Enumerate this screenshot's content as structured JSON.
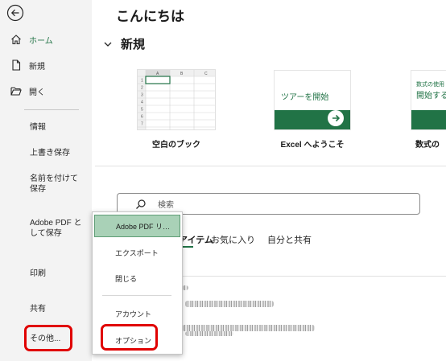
{
  "sidebar": {
    "items": [
      {
        "label": "ホーム",
        "icon": "home-icon"
      },
      {
        "label": "新規",
        "icon": "new-document-icon"
      },
      {
        "label": "開く",
        "icon": "open-folder-icon"
      }
    ],
    "text_items": [
      "情報",
      "上書き保存",
      "名前を付けて保存",
      "Adobe PDF として保存",
      "印刷",
      "共有",
      "その他..."
    ]
  },
  "main": {
    "greeting": "こんにちは",
    "new_section": "新規",
    "templates": [
      {
        "label": "空白のブック"
      },
      {
        "label": "Excel へようこそ",
        "tile_text": "ツアーを開始"
      },
      {
        "label": "数式の",
        "tile_text_small": "数式の使用",
        "tile_text": "開始する"
      }
    ],
    "spreadsheet": {
      "columns": [
        "A",
        "B",
        "C"
      ],
      "rows": [
        "1",
        "2",
        "3",
        "4",
        "5",
        "6",
        "7"
      ]
    },
    "search_placeholder": "検索",
    "tabs": {
      "recent": "アイテム",
      "favorites": "お気に入り",
      "shared": "自分と共有"
    }
  },
  "menu": {
    "items": [
      "Adobe PDF リ…",
      "エクスポート",
      "閉じる",
      "アカウント",
      "オプション"
    ]
  },
  "colors": {
    "accent": "#217346",
    "highlight": "#e00000",
    "menu_selected": "#a9d1b7"
  }
}
